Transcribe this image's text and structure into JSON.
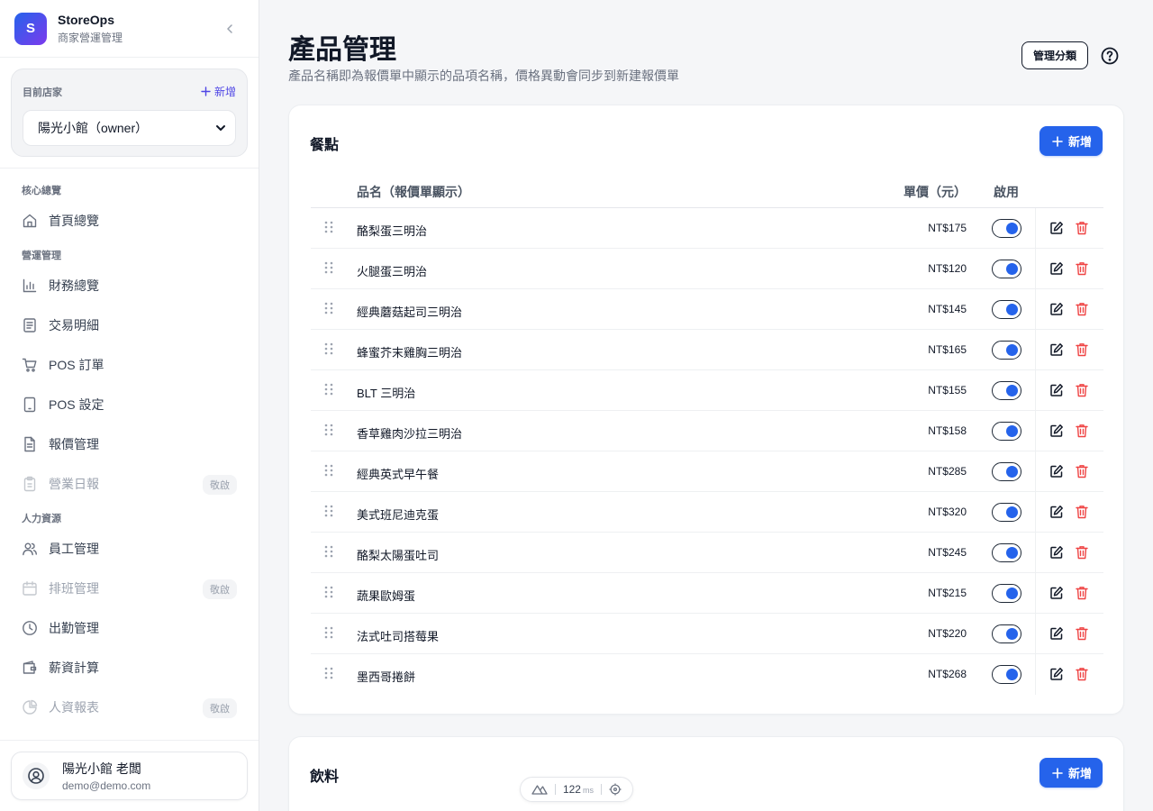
{
  "brand": {
    "logo_letter": "S",
    "name": "StoreOps",
    "subtitle": "商家營運管理"
  },
  "store": {
    "label": "目前店家",
    "add_label": "新增",
    "selected": "陽光小館（owner）"
  },
  "nav": {
    "sections": [
      {
        "title": "核心總覽",
        "items": [
          {
            "label": "首頁總覽",
            "icon": "home-icon"
          }
        ]
      },
      {
        "title": "營運管理",
        "items": [
          {
            "label": "財務總覽",
            "icon": "bar-chart-icon"
          },
          {
            "label": "交易明細",
            "icon": "list-doc-icon"
          },
          {
            "label": "POS 訂單",
            "icon": "cart-icon"
          },
          {
            "label": "POS 設定",
            "icon": "tablet-icon"
          },
          {
            "label": "報價管理",
            "icon": "file-icon"
          },
          {
            "label": "營業日報",
            "icon": "clipboard-icon",
            "badge": "敬啟",
            "disabled": true
          }
        ]
      },
      {
        "title": "人力資源",
        "items": [
          {
            "label": "員工管理",
            "icon": "users-icon"
          },
          {
            "label": "排班管理",
            "icon": "calendar-icon",
            "badge": "敬啟",
            "disabled": true
          },
          {
            "label": "出勤管理",
            "icon": "clock-icon"
          },
          {
            "label": "薪資計算",
            "icon": "wallet-icon"
          },
          {
            "label": "人資報表",
            "icon": "pie-chart-icon",
            "badge": "敬啟",
            "disabled": true
          }
        ]
      }
    ]
  },
  "user": {
    "name": "陽光小館 老闆",
    "email": "demo@demo.com"
  },
  "page": {
    "title": "產品管理",
    "description": "產品名稱即為報價單中顯示的品項名稱，價格異動會同步到新建報價單",
    "manage_categories_label": "管理分類"
  },
  "table_headers": {
    "name": "品名（報價單顯示）",
    "price": "單價（元）",
    "enabled": "啟用"
  },
  "categories": [
    {
      "title": "餐點",
      "add_label": "新增",
      "products": [
        {
          "name": "酪梨蛋三明治",
          "price": "NT$175",
          "enabled": true
        },
        {
          "name": "火腿蛋三明治",
          "price": "NT$120",
          "enabled": true
        },
        {
          "name": "經典蘑菇起司三明治",
          "price": "NT$145",
          "enabled": true
        },
        {
          "name": "蜂蜜芥末雞胸三明治",
          "price": "NT$165",
          "enabled": true
        },
        {
          "name": "BLT 三明治",
          "price": "NT$155",
          "enabled": true
        },
        {
          "name": "香草雞肉沙拉三明治",
          "price": "NT$158",
          "enabled": true
        },
        {
          "name": "經典英式早午餐",
          "price": "NT$285",
          "enabled": true
        },
        {
          "name": "美式班尼迪克蛋",
          "price": "NT$320",
          "enabled": true
        },
        {
          "name": "酪梨太陽蛋吐司",
          "price": "NT$245",
          "enabled": true
        },
        {
          "name": "蔬果歐姆蛋",
          "price": "NT$215",
          "enabled": true
        },
        {
          "name": "法式吐司搭莓果",
          "price": "NT$220",
          "enabled": true
        },
        {
          "name": "墨西哥捲餅",
          "price": "NT$268",
          "enabled": true
        }
      ]
    },
    {
      "title": "飲料",
      "add_label": "新增",
      "products": []
    }
  ],
  "perf": {
    "value": "122",
    "unit": "ms"
  },
  "colors": {
    "primary": "#2563eb",
    "danger": "#ef4444",
    "brand_gradient": [
      "#2563eb",
      "#7c3aed"
    ]
  }
}
